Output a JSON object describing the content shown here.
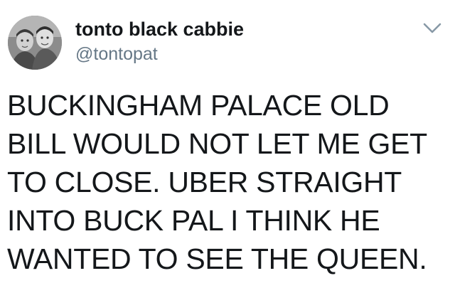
{
  "tweet": {
    "author": {
      "display_name": "tonto black cabbie",
      "handle": "@tontopat"
    },
    "lines": [
      "BUCKINGHAM PALACE OLD",
      "BILL WOULD NOT LET ME GET",
      "TO CLOSE. UBER STRAIGHT",
      "INTO BUCK PAL I THINK HE",
      "WANTED TO SEE THE QUEEN."
    ]
  },
  "icons": {
    "menu": "chevron-down-icon",
    "avatar": "avatar-photo"
  },
  "colors": {
    "text": "#14171a",
    "secondary_text": "#657786",
    "caret": "#8899a6",
    "background": "#ffffff"
  }
}
